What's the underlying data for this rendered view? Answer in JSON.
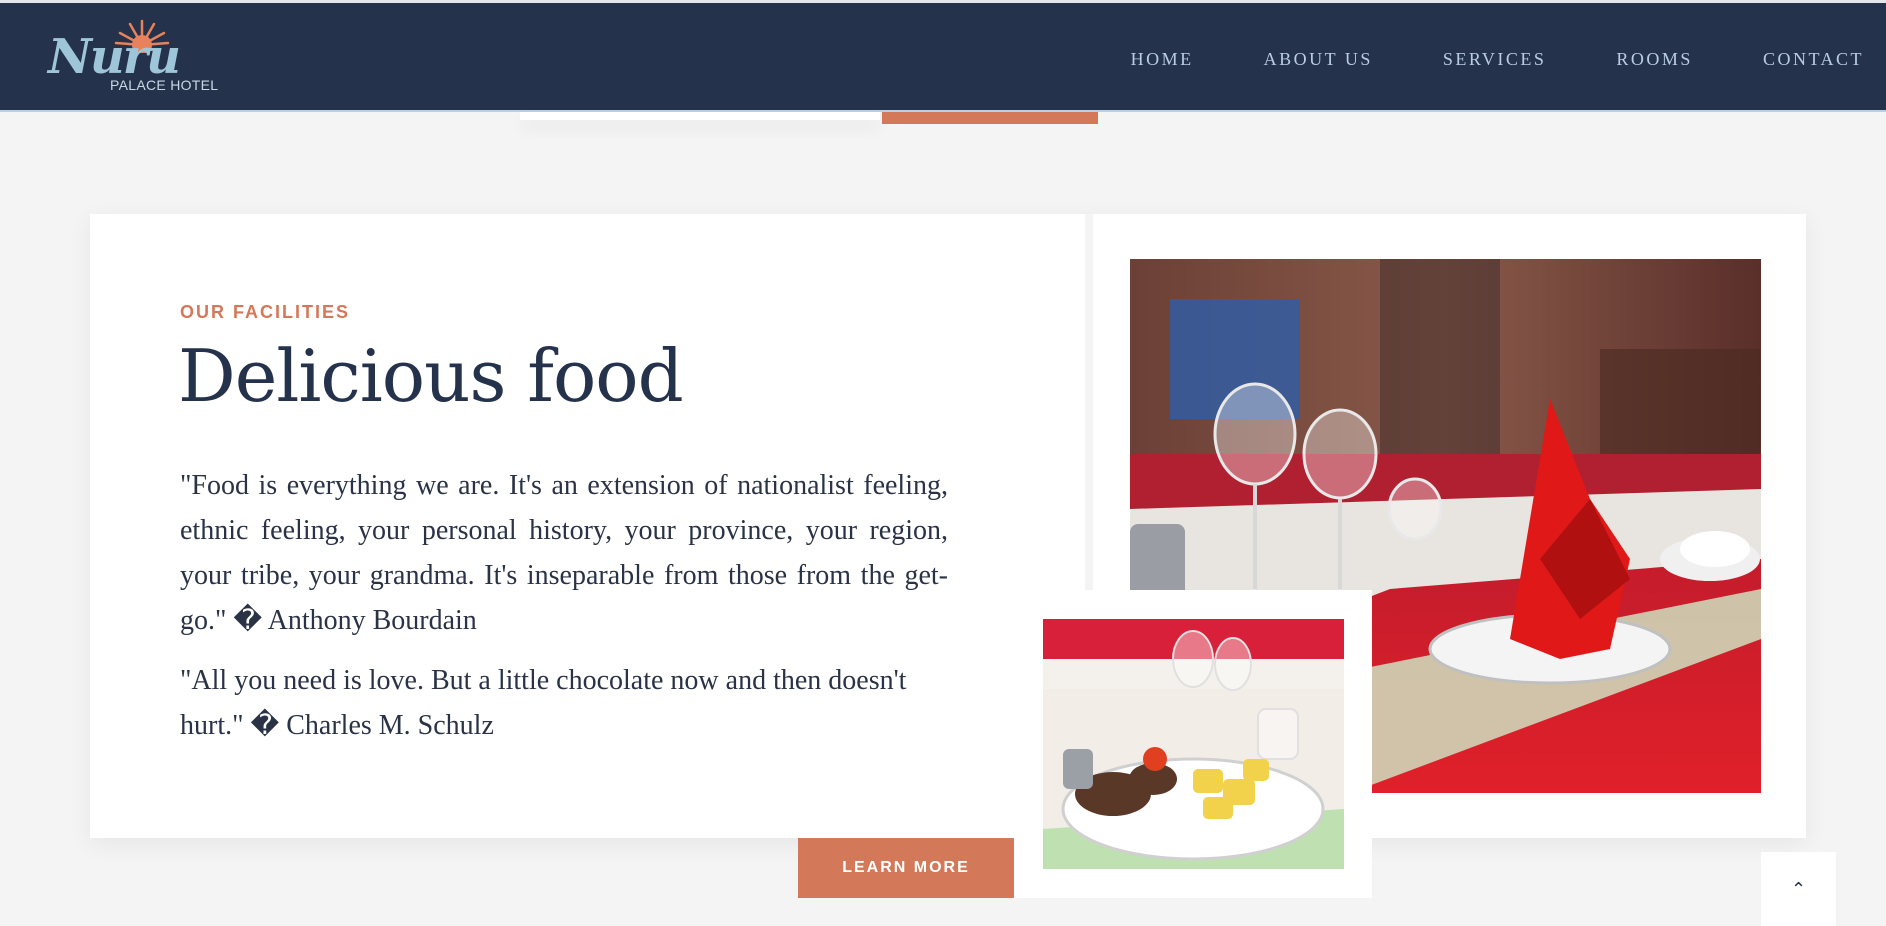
{
  "header": {
    "logo_script": "Nuru",
    "logo_sub": "PALACE HOTEL",
    "nav": [
      "HOME",
      "ABOUT US",
      "SERVICES",
      "ROOMS",
      "CONTACT"
    ]
  },
  "section": {
    "eyebrow": "OUR FACILITIES",
    "title": "Delicious food",
    "quote1": "\"Food is everything we are. It's an extension of nationalist feeling, ethnic feeling, your personal history, your province, your region, your tribe, your grandma. It's inseparable from those from the get-go.\" � Anthony Bourdain",
    "quote2": "\"All you need is love. But a little chocolate now and then doesn't hurt.\" � Charles M. Schulz",
    "button": "LEARN MORE"
  },
  "photos": {
    "main": "dining-table-photo",
    "small": "plated-meal-photo"
  },
  "scroll_top_icon": "chevron-up-icon",
  "colors": {
    "navy": "#24324b",
    "accent": "#d4785a",
    "nav_text": "#b8cde3",
    "background": "#f4f4f4"
  }
}
